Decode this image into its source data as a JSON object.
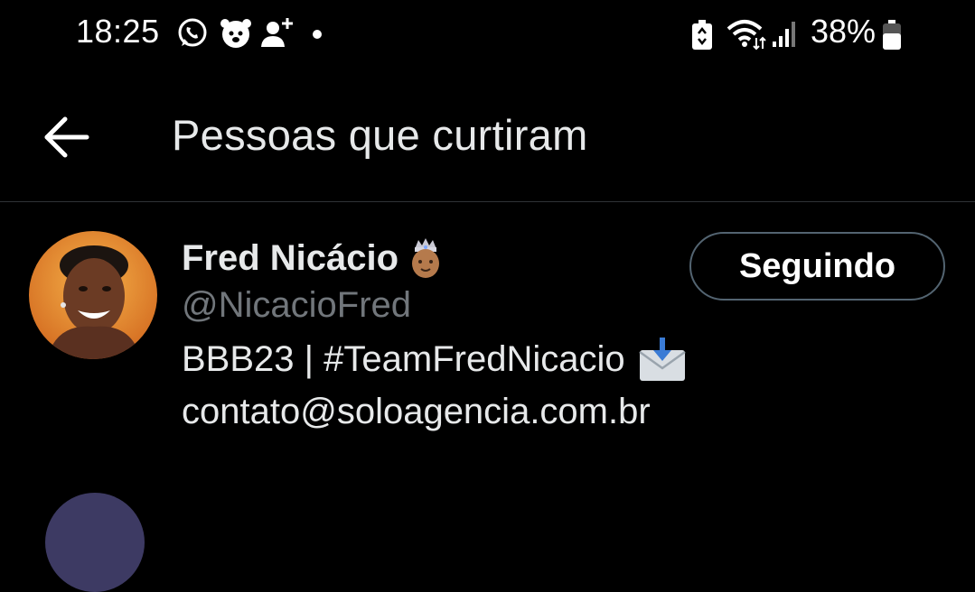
{
  "status_bar": {
    "time": "18:25",
    "battery_percent": "38%",
    "icons": [
      "whatsapp-icon",
      "bubble-icon",
      "person-add-icon",
      "battery-saver-icon",
      "wifi-icon",
      "signal-icon",
      "battery-icon"
    ]
  },
  "header": {
    "title": "Pessoas que curtiram",
    "back_icon": "arrow-left-icon"
  },
  "users": [
    {
      "name": "Fred Nicácio",
      "handle": "@NicacioFred",
      "bio_line_1": "BBB23 | #TeamFredNicacio",
      "bio_line_2": "contato@soloagencia.com.br",
      "follow_label": "Seguindo",
      "name_emoji": "prince-emoji",
      "bio_emoji": "envelope-arrow-icon"
    }
  ],
  "colors": {
    "background": "#000000",
    "primary_text": "#e7e9ea",
    "secondary_text": "#71767b",
    "divider": "#2f3336",
    "button_border": "#536471"
  }
}
